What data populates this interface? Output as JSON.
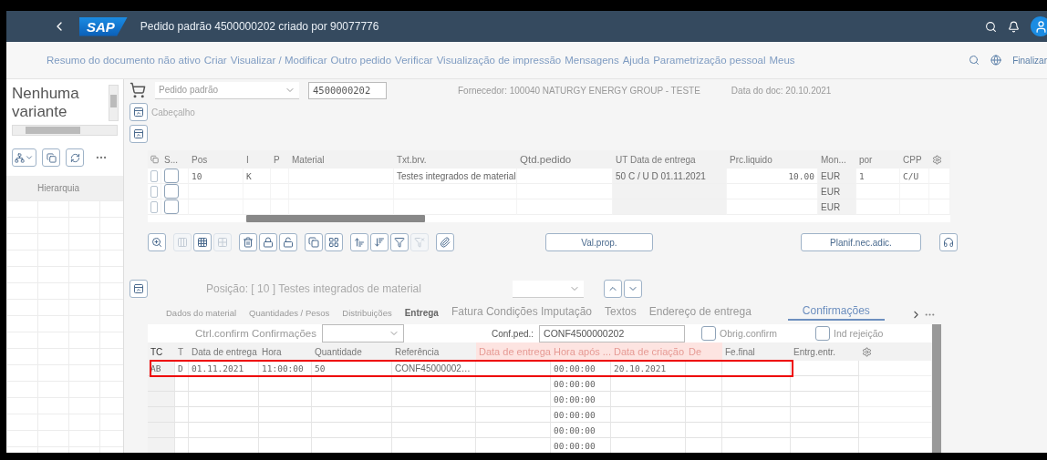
{
  "shell": {
    "logo": "SAP",
    "title": "Pedido padrão 4500000202 criado por 90077776"
  },
  "menu": {
    "items": [
      "Resumo do documento não ativo",
      "Criar",
      "Visualizar / Modificar",
      "Outro pedido",
      "Verificar",
      "Visualização de impressão",
      "Mensagens",
      "Ajuda",
      "Parametrização pessoal",
      "Meus"
    ],
    "exit": "Finalizar"
  },
  "sidebar": {
    "variant": "Nenhuma variante",
    "column": "Hierarquia"
  },
  "header": {
    "doc_type": "Pedido padrão",
    "doc_number": "4500000202",
    "supplier": "Fornecedor: 100040 NATURGY ENERGY GROUP - TESTE",
    "doc_date": "Data do doc: 20.10.2021",
    "section": "Cabeçalho"
  },
  "items": {
    "columns": [
      "S...",
      "Pos",
      "I",
      "P",
      "Material",
      "Txt.brv.",
      "Qtd.pedido",
      "UT Data de entrega",
      "Prc.liquido",
      "Mon...",
      "por",
      "CPP"
    ],
    "rows": [
      {
        "selected": false,
        "checked": false,
        "cells": [
          "",
          "10",
          "K",
          "",
          "",
          "Testes integrados de material",
          "",
          "50 C / U D 01.11.2021",
          "10.00",
          "EUR",
          "1",
          "C/U"
        ]
      },
      {
        "selected": false,
        "checked": false,
        "cells": [
          "",
          "",
          "",
          "",
          "",
          "",
          "",
          "",
          "",
          "EUR",
          "",
          ""
        ]
      },
      {
        "selected": false,
        "checked": false,
        "cells": [
          "",
          "",
          "",
          "",
          "",
          "",
          "",
          "",
          "",
          "EUR",
          "",
          ""
        ]
      }
    ]
  },
  "toolbar": [
    [
      {
        "kind": "zoom",
        "disabled": false
      }
    ],
    [
      {
        "kind": "columns",
        "disabled": true
      },
      {
        "kind": "select-all",
        "disabled": false
      },
      {
        "kind": "deselect-all",
        "disabled": true
      }
    ],
    [
      {
        "kind": "delete",
        "disabled": false
      },
      {
        "kind": "lock",
        "disabled": false
      },
      {
        "kind": "unlock",
        "disabled": false
      }
    ],
    [
      {
        "kind": "copy",
        "disabled": false
      },
      {
        "kind": "group",
        "disabled": false
      }
    ],
    [
      {
        "kind": "sort-asc",
        "disabled": false
      },
      {
        "kind": "sort-desc",
        "disabled": false
      },
      {
        "kind": "filter",
        "disabled": false
      },
      {
        "kind": "filter-clear",
        "disabled": true
      }
    ],
    [
      {
        "kind": "attach",
        "disabled": false
      }
    ]
  ],
  "item_buttons": [
    "Val.prop.",
    "Planif.nec.adic."
  ],
  "detail": {
    "position": "Posição: [ 10 ] Testes integrados de material",
    "tabs": [
      {
        "label": "Dados do material",
        "selected": false
      },
      {
        "label": "Quantidades / Pesos",
        "selected": false
      },
      {
        "label": "Distribuições",
        "selected": false
      },
      {
        "label": "Entrega",
        "selected": false
      },
      {
        "label": "Fatura Condições Imputação",
        "selected": false
      },
      {
        "label": "Textos",
        "selected": false
      },
      {
        "label": "Endereço de entrega",
        "selected": false
      },
      {
        "label": "Confirmações",
        "selected": true
      }
    ],
    "control_label": "Ctrl.confirm Confirmações",
    "conf_label": "Conf.ped.:",
    "conf_value": "CONF4500000202",
    "checkboxes": [
      {
        "label": "Obrig.confirm",
        "checked": false
      },
      {
        "label": "Ind rejeição",
        "checked": false
      }
    ],
    "table": {
      "columns": [
        {
          "label": "TC",
          "highlighted": false
        },
        {
          "label": "T",
          "highlighted": false
        },
        {
          "label": "Data de entrega",
          "highlighted": false
        },
        {
          "label": "Hora",
          "highlighted": false
        },
        {
          "label": "Quantidade",
          "highlighted": false
        },
        {
          "label": "Referência",
          "highlighted": false
        },
        {
          "label": "Data de entrega",
          "highlighted": true
        },
        {
          "label": "Hora após ...",
          "highlighted": true
        },
        {
          "label": "Data de criação",
          "highlighted": true
        },
        {
          "label": "De",
          "highlighted": true
        },
        {
          "label": "Fe.final",
          "highlighted": false
        },
        {
          "label": "Entrg.entr.",
          "highlighted": false
        }
      ],
      "rows": [
        {
          "highlighted": true,
          "cells": [
            "AB",
            "D",
            "01.11.2021",
            "11:00:00",
            "50",
            "CONF45000002…",
            "",
            "00:00:00",
            "20.10.2021",
            "",
            "",
            ""
          ]
        },
        {
          "highlighted": false,
          "cells": [
            "",
            "",
            "",
            "",
            "",
            "",
            "",
            "00:00:00",
            "",
            "",
            "",
            ""
          ]
        },
        {
          "highlighted": false,
          "cells": [
            "",
            "",
            "",
            "",
            "",
            "",
            "",
            "00:00:00",
            "",
            "",
            "",
            ""
          ]
        },
        {
          "highlighted": false,
          "cells": [
            "",
            "",
            "",
            "",
            "",
            "",
            "",
            "00:00:00",
            "",
            "",
            "",
            ""
          ]
        },
        {
          "highlighted": false,
          "cells": [
            "",
            "",
            "",
            "",
            "",
            "",
            "",
            "00:00:00",
            "",
            "",
            "",
            ""
          ]
        },
        {
          "highlighted": false,
          "cells": [
            "",
            "",
            "",
            "",
            "",
            "",
            "",
            "00:00:00",
            "",
            "",
            "",
            ""
          ]
        }
      ]
    }
  }
}
